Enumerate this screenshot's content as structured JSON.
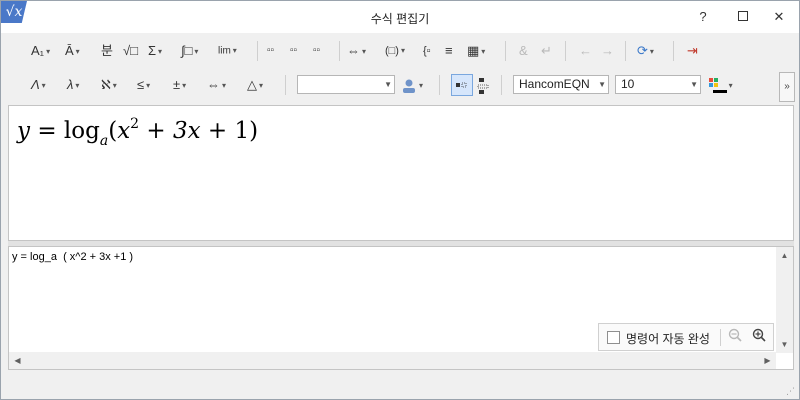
{
  "window": {
    "title": "수식 편집기",
    "app_icon": "√x",
    "help": "?",
    "minimize": "—",
    "maximize": "☐",
    "close": "✕"
  },
  "toolbar1": {
    "items": [
      {
        "name": "font-style-icon",
        "glyph": "A₁",
        "dropdown": true
      },
      {
        "name": "accent-icon",
        "glyph": "Ā",
        "dropdown": true
      },
      {
        "name": "fraction-icon",
        "glyph": "분",
        "dropdown": false
      },
      {
        "name": "root-icon",
        "glyph": "√□",
        "dropdown": false
      },
      {
        "name": "sum-icon",
        "glyph": "Σ",
        "dropdown": true
      },
      {
        "name": "integral-icon",
        "glyph": "∫□",
        "dropdown": true
      },
      {
        "name": "limit-icon",
        "glyph": "lim",
        "dropdown": true
      },
      {
        "name": "matrix-1-icon",
        "glyph": "▫▫",
        "dropdown": false
      },
      {
        "name": "matrix-2-icon",
        "glyph": "▫▫",
        "dropdown": false
      },
      {
        "name": "matrix-3-icon",
        "glyph": "▫▫",
        "dropdown": false
      },
      {
        "name": "arrow-layout-icon",
        "glyph": "⇔",
        "dropdown": true
      },
      {
        "name": "bracket-icon",
        "glyph": "(□)",
        "dropdown": true
      },
      {
        "name": "cases-icon",
        "glyph": "{▫",
        "dropdown": false
      },
      {
        "name": "align-icon",
        "glyph": "≡",
        "dropdown": false
      },
      {
        "name": "grid-icon",
        "glyph": "▦",
        "dropdown": true
      },
      {
        "name": "ampersand-icon",
        "glyph": "&",
        "dropdown": false,
        "disabled": true
      },
      {
        "name": "newline-icon",
        "glyph": "↵",
        "dropdown": false,
        "disabled": true
      },
      {
        "name": "undo-icon",
        "glyph": "←",
        "dropdown": false,
        "disabled": true
      },
      {
        "name": "redo-icon",
        "glyph": "→",
        "dropdown": false,
        "disabled": true
      },
      {
        "name": "convert-icon",
        "glyph": "⟳",
        "dropdown": true
      },
      {
        "name": "exit-icon",
        "glyph": "⇥",
        "dropdown": false
      }
    ]
  },
  "toolbar2": {
    "items": [
      {
        "name": "greek-upper-icon",
        "glyph": "Λ"
      },
      {
        "name": "greek-lower-icon",
        "glyph": "λ"
      },
      {
        "name": "special-char-icon",
        "glyph": "ℵ"
      },
      {
        "name": "relation-icon",
        "glyph": "≤"
      },
      {
        "name": "operator-icon",
        "glyph": "±"
      },
      {
        "name": "arrow-icon",
        "glyph": "⇔"
      },
      {
        "name": "misc-symbol-icon",
        "glyph": "△"
      }
    ],
    "style_combo": "",
    "font_combo": "HancomEQN",
    "size_combo": "10",
    "text_color": "#000000"
  },
  "preview": {
    "lhs": "y",
    "eq": "=",
    "log": "log",
    "base": "a",
    "open": "(",
    "x": "x",
    "exp": "2",
    "plus1": "+",
    "term": "3x",
    "plus2": "+",
    "one": "1",
    "close": ")"
  },
  "editor": {
    "script": "y = log_a  ( x^2 + 3x +1 )"
  },
  "autocomplete": {
    "label": "명령어 자동 완성",
    "checked": false
  }
}
